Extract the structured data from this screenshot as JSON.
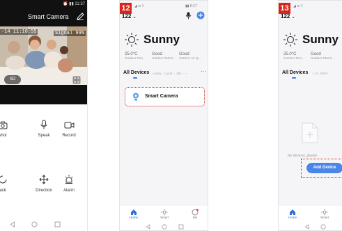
{
  "camera_screen": {
    "status_right": "⏰ ▮▮ 11:37",
    "title": "Smart Camera",
    "timestamp": "-14 11:10:55",
    "signal": "Signal 99%",
    "sd_label": "SD",
    "controls": [
      {
        "label": "shot",
        "icon": "camera-icon"
      },
      {
        "label": "Speak",
        "icon": "microphone-icon"
      },
      {
        "label": "Record",
        "icon": "video-icon"
      },
      {
        "label": "ack",
        "icon": "playback-icon"
      },
      {
        "label": "Direction",
        "icon": "direction-icon"
      },
      {
        "label": "Alarm",
        "icon": "alarm-light-icon"
      }
    ]
  },
  "step_12": {
    "step": "12",
    "status_right": "▮▮ 5:17",
    "home_name": "122",
    "weather": "Sunny",
    "stats": [
      {
        "value": "25.0°C",
        "label": "Outdoor Tem..."
      },
      {
        "value": "Good",
        "label": "Outdoor PM2.5"
      },
      {
        "value": "Good",
        "label": "Outdoor Air Q..."
      }
    ],
    "tab_main": "All Devices",
    "device_name": "Smart Camera",
    "tabs": [
      {
        "label": "Home"
      },
      {
        "label": "Smart"
      },
      {
        "label": "Me"
      }
    ]
  },
  "step_13": {
    "step": "13",
    "home_name": "122",
    "weather": "Sunny",
    "stats": [
      {
        "value": "25.0°C",
        "label": "Outdoor Tem..."
      },
      {
        "value": "Good",
        "label": "Outdoor PM2.5"
      }
    ],
    "tab_main": "All Devices",
    "empty_text": "No devices, please",
    "add_device": "Add Device",
    "tabs": [
      {
        "label": "Home"
      },
      {
        "label": "Smart"
      }
    ]
  },
  "colors": {
    "accent_blue": "#4a86e8",
    "step_red": "#d8251c",
    "highlight_dots": "#c9241b"
  }
}
